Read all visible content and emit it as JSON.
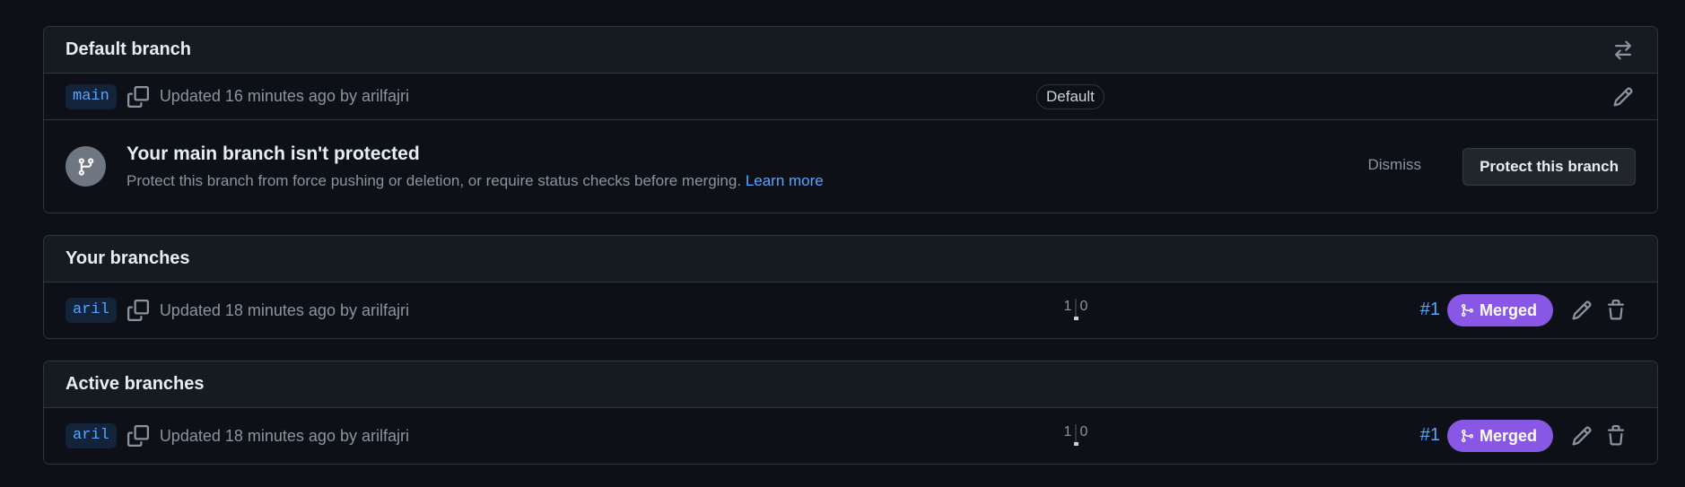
{
  "default_branch": {
    "title": "Default branch",
    "branch": {
      "name": "main",
      "updated": "Updated 16 minutes ago by arilfajri",
      "label": "Default"
    },
    "notice": {
      "title": "Your main branch isn't protected",
      "description": "Protect this branch from force pushing or deletion, or require status checks before merging.",
      "learn_more": "Learn more",
      "dismiss": "Dismiss",
      "protect_button": "Protect this branch"
    }
  },
  "your_branches": {
    "title": "Your branches",
    "rows": [
      {
        "name": "aril",
        "updated": "Updated 18 minutes ago by arilfajri",
        "behind": "1",
        "ahead": "0",
        "pr_number": "#1",
        "pr_status": "Merged"
      }
    ]
  },
  "active_branches": {
    "title": "Active branches",
    "rows": [
      {
        "name": "aril",
        "updated": "Updated 18 minutes ago by arilfajri",
        "behind": "1",
        "ahead": "0",
        "pr_number": "#1",
        "pr_status": "Merged"
      }
    ]
  },
  "icons": {
    "switch": "arrow-switch-icon",
    "copy": "copy-icon",
    "edit": "pencil-icon",
    "delete": "trash-icon",
    "branch": "git-branch-icon",
    "merge": "git-merge-icon"
  },
  "colors": {
    "background": "#0d1117",
    "header": "#161b22",
    "border": "#30363d",
    "accent_link": "#58a6ff",
    "merged": "#8957e5"
  }
}
